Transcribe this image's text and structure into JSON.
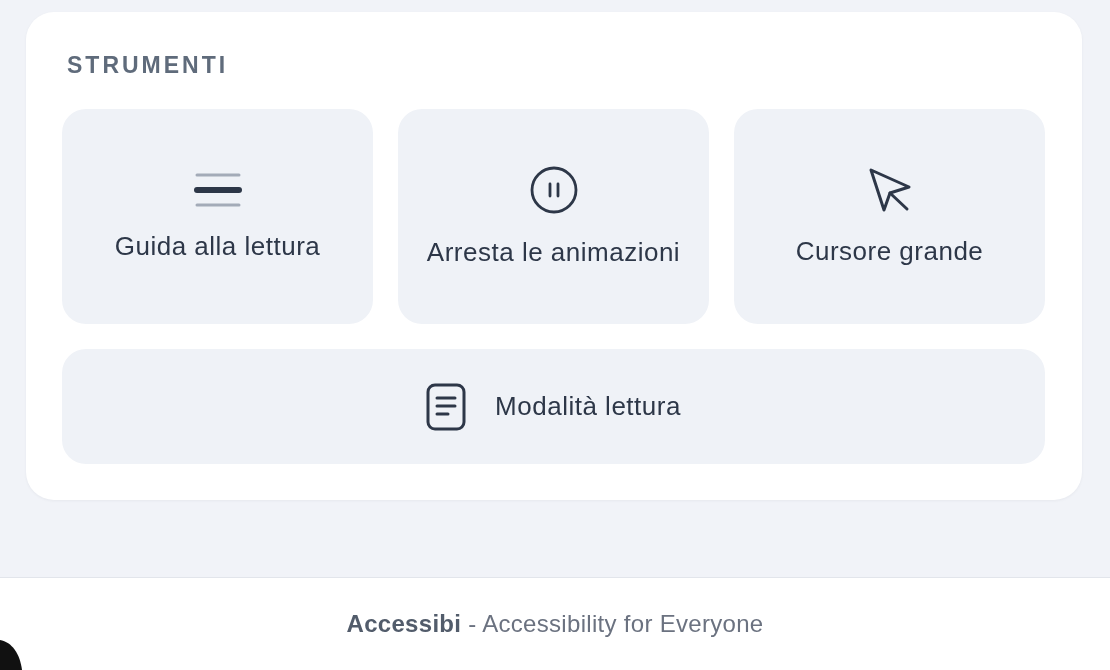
{
  "tools_section": {
    "title": "STRUMENTI",
    "tools": [
      {
        "label": "Guida alla lettura",
        "kind": "tile"
      },
      {
        "label": "Arresta le animazioni",
        "kind": "tile"
      },
      {
        "label": "Cursore grande",
        "kind": "tile"
      },
      {
        "label": "Modalità lettura",
        "kind": "wide"
      }
    ]
  },
  "footer": {
    "text": "**Accessibi** - Accessibility for Everyone"
  }
}
